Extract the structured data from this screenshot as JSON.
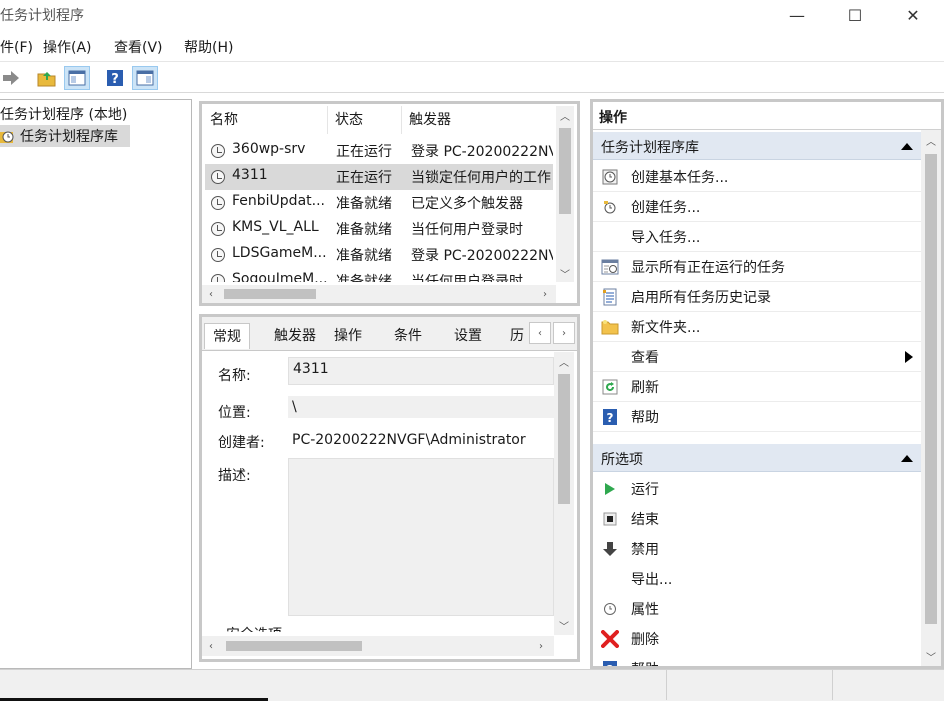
{
  "window": {
    "title": "任务计划程序",
    "minimize": "—",
    "maximize": "☐",
    "close": "✕"
  },
  "menu": [
    "‌件(F)",
    "操作(A)",
    "查看(V)",
    "帮助(H)"
  ],
  "tree": {
    "root": "任务计划程序 (本地)",
    "library": "任务计划程序库"
  },
  "task_list": {
    "columns": [
      "名称",
      "状态",
      "触发器"
    ],
    "rows": [
      {
        "name": "360wp-srv",
        "status": "正在运行",
        "trigger": "登录 PC-20200222NV"
      },
      {
        "name": "4311",
        "status": "正在运行",
        "trigger": "当锁定任何用户的工作"
      },
      {
        "name": "FenbiUpdat...",
        "status": "准备就绪",
        "trigger": "已定义多个触发器"
      },
      {
        "name": "KMS_VL_ALL",
        "status": "准备就绪",
        "trigger": "当任何用户登录时"
      },
      {
        "name": "LDSGameM...",
        "status": "准备就绪",
        "trigger": "登录 PC-20200222NV"
      },
      {
        "name": "SogouImeM...",
        "status": "准备就绪",
        "trigger": "当任何用户登录时"
      }
    ]
  },
  "detail": {
    "tabs": [
      "常规",
      "触发器",
      "操作",
      "条件",
      "设置",
      "历"
    ],
    "name_label": "名称:",
    "name_value": "4311",
    "location_label": "位置:",
    "location_value": "\\",
    "author_label": "创建者:",
    "author_value": "PC-20200222NVGF\\Administrator",
    "desc_label": "描述:",
    "security_label": "安全选项"
  },
  "actions": {
    "header": "操作",
    "group1": "任务计划程序库",
    "group1_items": [
      {
        "label": "创建基本任务...",
        "icon": "create-basic-task-icon"
      },
      {
        "label": "创建任务...",
        "icon": "create-task-icon"
      },
      {
        "label": "导入任务...",
        "icon": ""
      },
      {
        "label": "显示所有正在运行的任务",
        "icon": "running-tasks-icon"
      },
      {
        "label": "启用所有任务历史记录",
        "icon": "history-icon"
      },
      {
        "label": "新文件夹...",
        "icon": "folder-icon"
      },
      {
        "label": "查看",
        "icon": ""
      },
      {
        "label": "刷新",
        "icon": "refresh-icon"
      },
      {
        "label": "帮助",
        "icon": "help-icon"
      }
    ],
    "group2": "所选项",
    "group2_items": [
      {
        "label": "运行",
        "icon": "run-icon"
      },
      {
        "label": "结束",
        "icon": "stop-icon"
      },
      {
        "label": "禁用",
        "icon": "disable-icon"
      },
      {
        "label": "导出...",
        "icon": ""
      },
      {
        "label": "属性",
        "icon": "properties-icon"
      },
      {
        "label": "删除",
        "icon": "delete-icon"
      },
      {
        "label": "帮助",
        "icon": "help-icon"
      }
    ]
  },
  "colors": {
    "selection": "#d9d9d9",
    "group_header": "#e1e8f2",
    "run_green": "#2fa84f",
    "delete_red": "#e02020",
    "help_blue": "#2a5db0"
  }
}
